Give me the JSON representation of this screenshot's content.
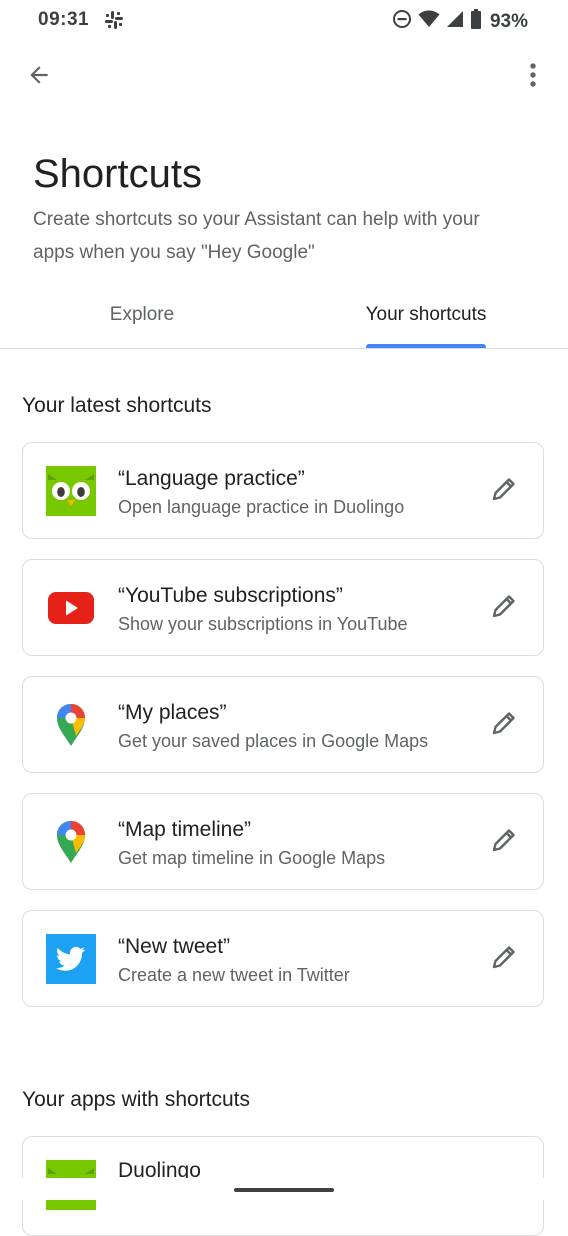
{
  "status_bar": {
    "time": "09:31",
    "battery": "93%",
    "icons": [
      "slack-icon",
      "do-not-disturb-icon",
      "wifi-icon",
      "signal-icon",
      "battery-icon"
    ]
  },
  "app_bar": {
    "back_icon": "arrow-back-icon",
    "more_icon": "more-vert-icon"
  },
  "header": {
    "title": "Shortcuts",
    "subtitle": "Create shortcuts so your Assistant can help with your apps when you say \"Hey Google\""
  },
  "tabs": [
    {
      "label": "Explore",
      "selected": false
    },
    {
      "label": "Your shortcuts",
      "selected": true
    }
  ],
  "colors": {
    "accent": "#4285f4",
    "duolingo": "#78c800",
    "youtube": "#ff0000",
    "twitter": "#1da1f2"
  },
  "latest": {
    "title": "Your latest shortcuts",
    "items": [
      {
        "title": "“Language practice”",
        "subtitle": "Open language practice in Duolingo",
        "icon": "duolingo-icon"
      },
      {
        "title": "“YouTube subscriptions”",
        "subtitle": "Show your subscriptions in YouTube",
        "icon": "youtube-icon"
      },
      {
        "title": "“My places”",
        "subtitle": "Get your saved places in Google Maps",
        "icon": "google-maps-icon"
      },
      {
        "title": "“Map timeline”",
        "subtitle": "Get map timeline in Google Maps",
        "icon": "google-maps-icon"
      },
      {
        "title": "“New tweet”",
        "subtitle": "Create a new tweet in Twitter",
        "icon": "twitter-icon"
      }
    ]
  },
  "apps": {
    "title": "Your apps with shortcuts",
    "items": [
      {
        "name": "Duolingo",
        "icon": "duolingo-icon"
      }
    ]
  }
}
